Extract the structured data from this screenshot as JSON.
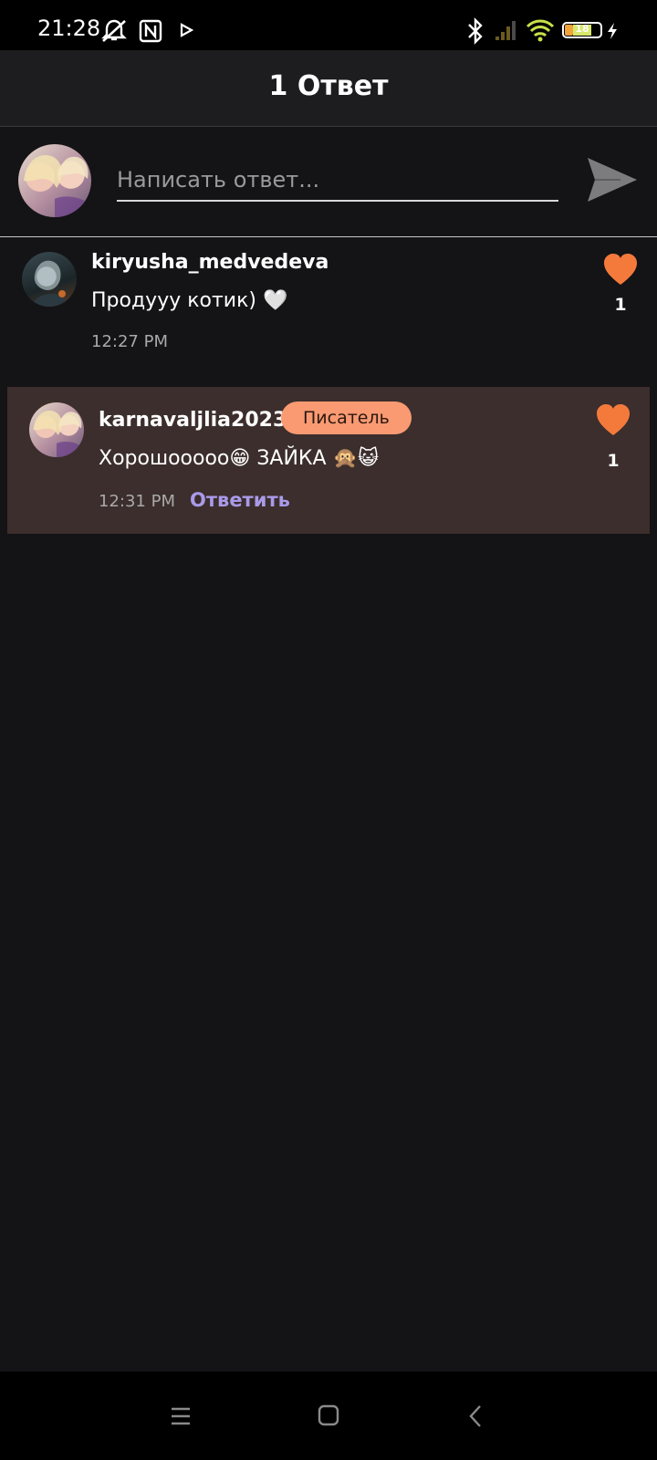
{
  "status_bar": {
    "time": "21:28",
    "battery": "18",
    "icons": [
      "bell-muted-icon",
      "nfc-icon",
      "play-icon",
      "bluetooth-icon",
      "signal-icon",
      "wifi-icon",
      "battery-icon",
      "charging-icon"
    ]
  },
  "header": {
    "title": "1 Ответ"
  },
  "compose": {
    "placeholder": "Написать ответ...",
    "send_icon": "send-icon"
  },
  "comments": [
    {
      "username": "kiryusha_medvedeva",
      "text": "Продууу котик) 🤍",
      "time": "12:27 PM",
      "likes": "1",
      "highlighted": false
    },
    {
      "username": "karnavaljlia2023",
      "badge": "Писатель",
      "text": "Хорошоoooo😁 ЗАЙКА 🙊😺",
      "time": "12:31 PM",
      "reply_label": "Ответить",
      "likes": "1",
      "highlighted": true
    }
  ],
  "colors": {
    "background": "#141315",
    "header": "#1d1c1e",
    "highlight_row": "#3b2e2c",
    "like": "#f47a3c",
    "badge": "#f99a72",
    "reply_link": "#a99ae9"
  },
  "nav_bar": {
    "icons": [
      "menu-icon",
      "home-icon",
      "back-icon"
    ]
  }
}
